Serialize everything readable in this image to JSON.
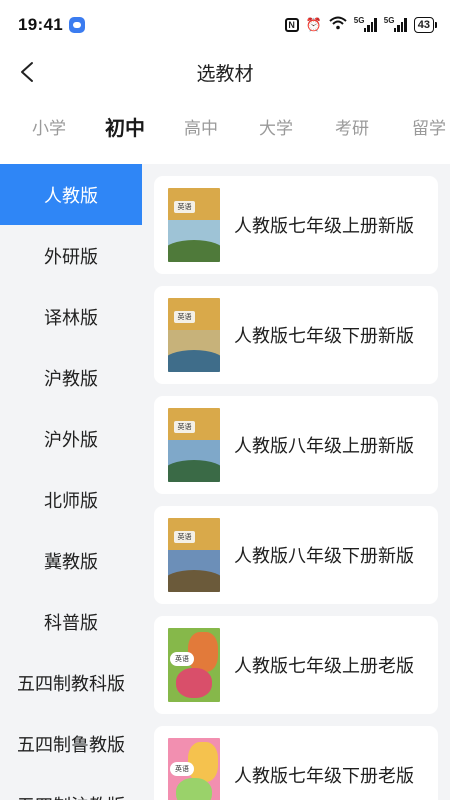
{
  "status_bar": {
    "time": "19:41",
    "signal1_label": "5G",
    "signal2_label": "5G",
    "battery": "43"
  },
  "header": {
    "title": "选教材"
  },
  "level_tabs": [
    {
      "label": "小学",
      "active": false
    },
    {
      "label": "初中",
      "active": true
    },
    {
      "label": "高中",
      "active": false
    },
    {
      "label": "大学",
      "active": false
    },
    {
      "label": "考研",
      "active": false
    },
    {
      "label": "留学",
      "active": false
    }
  ],
  "publishers": [
    {
      "label": "人教版",
      "active": true
    },
    {
      "label": "外研版",
      "active": false
    },
    {
      "label": "译林版",
      "active": false
    },
    {
      "label": "沪教版",
      "active": false
    },
    {
      "label": "沪外版",
      "active": false
    },
    {
      "label": "北师版",
      "active": false
    },
    {
      "label": "冀教版",
      "active": false
    },
    {
      "label": "科普版",
      "active": false
    },
    {
      "label": "五四制教科版",
      "active": false
    },
    {
      "label": "五四制鲁教版",
      "active": false
    },
    {
      "label": "五四制沪教版",
      "active": false
    }
  ],
  "books": [
    {
      "title": "人教版七年级上册新版",
      "cover_label": "英语",
      "cover_style": "new",
      "sky": "#9ec3d6",
      "ground": "#4f7a3a"
    },
    {
      "title": "人教版七年级下册新版",
      "cover_label": "英语",
      "cover_style": "new",
      "sky": "#c7b27a",
      "ground": "#3f6d8a"
    },
    {
      "title": "人教版八年级上册新版",
      "cover_label": "英语",
      "cover_style": "new",
      "sky": "#7fa8c9",
      "ground": "#3a6a46"
    },
    {
      "title": "人教版八年级下册新版",
      "cover_label": "英语",
      "cover_style": "new",
      "sky": "#6c8fb8",
      "ground": "#6b5a3a"
    },
    {
      "title": "人教版七年级上册老版",
      "cover_label": "英语",
      "cover_style": "old",
      "sky": "",
      "ground": ""
    },
    {
      "title": "人教版七年级下册老版",
      "cover_label": "英语",
      "cover_style": "old-pink",
      "sky": "",
      "ground": ""
    }
  ],
  "colors": {
    "accent": "#2f86f6",
    "panel_bg": "#f3f4f6"
  }
}
